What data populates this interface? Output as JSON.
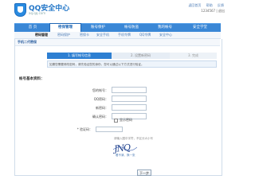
{
  "brand": {
    "title": "QQ安全中心",
    "subtitle": "aq.qq.com"
  },
  "top_links": [
    "返回首页",
    "帮助",
    "反馈"
  ],
  "user_bar": "1234567 | 退出",
  "nav": {
    "items": [
      "首 页",
      "密保管理",
      "账号保护",
      "帐号防盗",
      "我的帐号",
      "安全学堂"
    ]
  },
  "subnav": {
    "items": [
      "密码管理",
      "密码保护",
      "密保卡",
      "安全手机",
      "手机令牌",
      "QQ令牌",
      "安全中心"
    ]
  },
  "section_title": "手机二代密保",
  "steps": [
    "1. 填写帐号信息",
    "2. 设置新密码",
    "3. 完成"
  ],
  "notice": "如果您需要修改密码，请先验证您的身份，您可以通过以下方式进行验证。",
  "form": {
    "title": "帐号基本资料：",
    "fields": [
      "您的帐号：",
      "QQ密码：",
      "新密码：",
      "确认密码："
    ],
    "remember": "显示密码",
    "captcha_label": "* 验证码：",
    "captcha_hint": "请输入图中字符，不区分大小写",
    "captcha_text": "JNQ",
    "refresh": "看不清，换一张",
    "next": "下一步"
  },
  "colors": {
    "accent": "#3a87d6",
    "active_step": "#2d7fd2"
  }
}
